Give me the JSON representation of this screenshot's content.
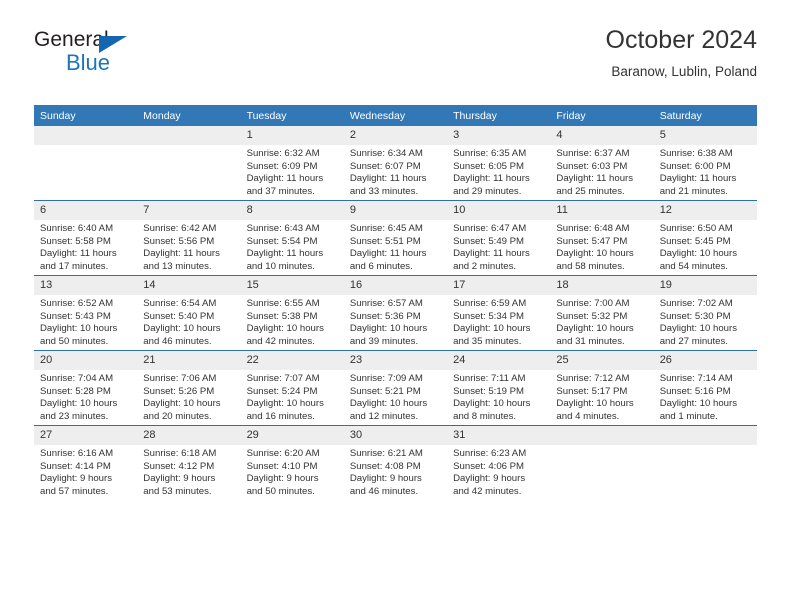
{
  "logo": {
    "word_top": "General",
    "word_bottom": "Blue",
    "triangle_color": "#1267b0",
    "blue_color": "#1b75bb"
  },
  "header": {
    "title": "October 2024",
    "location": "Baranow, Lublin, Poland"
  },
  "theme": {
    "header_row_bg": "#3278b6",
    "week_separator": "#2f6fa8",
    "daynum_bg": "#eeeeee",
    "text": "#333333"
  },
  "calendar": {
    "weekday_headers": [
      "Sunday",
      "Monday",
      "Tuesday",
      "Wednesday",
      "Thursday",
      "Friday",
      "Saturday"
    ],
    "weeks": [
      [
        {
          "day": "",
          "lines": []
        },
        {
          "day": "",
          "lines": []
        },
        {
          "day": "1",
          "lines": [
            "Sunrise: 6:32 AM",
            "Sunset: 6:09 PM",
            "Daylight: 11 hours",
            "and 37 minutes."
          ]
        },
        {
          "day": "2",
          "lines": [
            "Sunrise: 6:34 AM",
            "Sunset: 6:07 PM",
            "Daylight: 11 hours",
            "and 33 minutes."
          ]
        },
        {
          "day": "3",
          "lines": [
            "Sunrise: 6:35 AM",
            "Sunset: 6:05 PM",
            "Daylight: 11 hours",
            "and 29 minutes."
          ]
        },
        {
          "day": "4",
          "lines": [
            "Sunrise: 6:37 AM",
            "Sunset: 6:03 PM",
            "Daylight: 11 hours",
            "and 25 minutes."
          ]
        },
        {
          "day": "5",
          "lines": [
            "Sunrise: 6:38 AM",
            "Sunset: 6:00 PM",
            "Daylight: 11 hours",
            "and 21 minutes."
          ]
        }
      ],
      [
        {
          "day": "6",
          "lines": [
            "Sunrise: 6:40 AM",
            "Sunset: 5:58 PM",
            "Daylight: 11 hours",
            "and 17 minutes."
          ]
        },
        {
          "day": "7",
          "lines": [
            "Sunrise: 6:42 AM",
            "Sunset: 5:56 PM",
            "Daylight: 11 hours",
            "and 13 minutes."
          ]
        },
        {
          "day": "8",
          "lines": [
            "Sunrise: 6:43 AM",
            "Sunset: 5:54 PM",
            "Daylight: 11 hours",
            "and 10 minutes."
          ]
        },
        {
          "day": "9",
          "lines": [
            "Sunrise: 6:45 AM",
            "Sunset: 5:51 PM",
            "Daylight: 11 hours",
            "and 6 minutes."
          ]
        },
        {
          "day": "10",
          "lines": [
            "Sunrise: 6:47 AM",
            "Sunset: 5:49 PM",
            "Daylight: 11 hours",
            "and 2 minutes."
          ]
        },
        {
          "day": "11",
          "lines": [
            "Sunrise: 6:48 AM",
            "Sunset: 5:47 PM",
            "Daylight: 10 hours",
            "and 58 minutes."
          ]
        },
        {
          "day": "12",
          "lines": [
            "Sunrise: 6:50 AM",
            "Sunset: 5:45 PM",
            "Daylight: 10 hours",
            "and 54 minutes."
          ]
        }
      ],
      [
        {
          "day": "13",
          "lines": [
            "Sunrise: 6:52 AM",
            "Sunset: 5:43 PM",
            "Daylight: 10 hours",
            "and 50 minutes."
          ]
        },
        {
          "day": "14",
          "lines": [
            "Sunrise: 6:54 AM",
            "Sunset: 5:40 PM",
            "Daylight: 10 hours",
            "and 46 minutes."
          ]
        },
        {
          "day": "15",
          "lines": [
            "Sunrise: 6:55 AM",
            "Sunset: 5:38 PM",
            "Daylight: 10 hours",
            "and 42 minutes."
          ]
        },
        {
          "day": "16",
          "lines": [
            "Sunrise: 6:57 AM",
            "Sunset: 5:36 PM",
            "Daylight: 10 hours",
            "and 39 minutes."
          ]
        },
        {
          "day": "17",
          "lines": [
            "Sunrise: 6:59 AM",
            "Sunset: 5:34 PM",
            "Daylight: 10 hours",
            "and 35 minutes."
          ]
        },
        {
          "day": "18",
          "lines": [
            "Sunrise: 7:00 AM",
            "Sunset: 5:32 PM",
            "Daylight: 10 hours",
            "and 31 minutes."
          ]
        },
        {
          "day": "19",
          "lines": [
            "Sunrise: 7:02 AM",
            "Sunset: 5:30 PM",
            "Daylight: 10 hours",
            "and 27 minutes."
          ]
        }
      ],
      [
        {
          "day": "20",
          "lines": [
            "Sunrise: 7:04 AM",
            "Sunset: 5:28 PM",
            "Daylight: 10 hours",
            "and 23 minutes."
          ]
        },
        {
          "day": "21",
          "lines": [
            "Sunrise: 7:06 AM",
            "Sunset: 5:26 PM",
            "Daylight: 10 hours",
            "and 20 minutes."
          ]
        },
        {
          "day": "22",
          "lines": [
            "Sunrise: 7:07 AM",
            "Sunset: 5:24 PM",
            "Daylight: 10 hours",
            "and 16 minutes."
          ]
        },
        {
          "day": "23",
          "lines": [
            "Sunrise: 7:09 AM",
            "Sunset: 5:21 PM",
            "Daylight: 10 hours",
            "and 12 minutes."
          ]
        },
        {
          "day": "24",
          "lines": [
            "Sunrise: 7:11 AM",
            "Sunset: 5:19 PM",
            "Daylight: 10 hours",
            "and 8 minutes."
          ]
        },
        {
          "day": "25",
          "lines": [
            "Sunrise: 7:12 AM",
            "Sunset: 5:17 PM",
            "Daylight: 10 hours",
            "and 4 minutes."
          ]
        },
        {
          "day": "26",
          "lines": [
            "Sunrise: 7:14 AM",
            "Sunset: 5:16 PM",
            "Daylight: 10 hours",
            "and 1 minute."
          ]
        }
      ],
      [
        {
          "day": "27",
          "lines": [
            "Sunrise: 6:16 AM",
            "Sunset: 4:14 PM",
            "Daylight: 9 hours",
            "and 57 minutes."
          ]
        },
        {
          "day": "28",
          "lines": [
            "Sunrise: 6:18 AM",
            "Sunset: 4:12 PM",
            "Daylight: 9 hours",
            "and 53 minutes."
          ]
        },
        {
          "day": "29",
          "lines": [
            "Sunrise: 6:20 AM",
            "Sunset: 4:10 PM",
            "Daylight: 9 hours",
            "and 50 minutes."
          ]
        },
        {
          "day": "30",
          "lines": [
            "Sunrise: 6:21 AM",
            "Sunset: 4:08 PM",
            "Daylight: 9 hours",
            "and 46 minutes."
          ]
        },
        {
          "day": "31",
          "lines": [
            "Sunrise: 6:23 AM",
            "Sunset: 4:06 PM",
            "Daylight: 9 hours",
            "and 42 minutes."
          ]
        },
        {
          "day": "",
          "lines": []
        },
        {
          "day": "",
          "lines": []
        }
      ]
    ]
  }
}
